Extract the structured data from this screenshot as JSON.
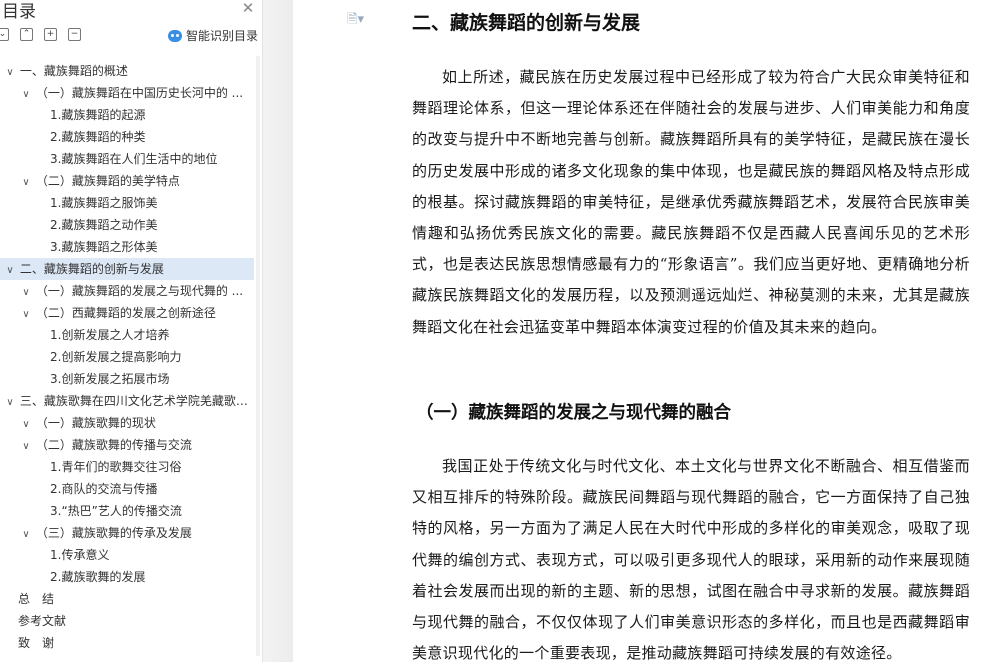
{
  "sidebar": {
    "title": "目录",
    "close_icon": "close-icon",
    "tools": [
      "collapse-all-icon",
      "expand-icon",
      "add-icon",
      "remove-icon"
    ],
    "ai_toc_label": "智能识别目录",
    "items": [
      {
        "label": "一、藏族舞蹈的概述",
        "level": 0,
        "expanded": true
      },
      {
        "label": "（一）藏族舞蹈在中国历史长河中的 ...",
        "level": 1,
        "expanded": true
      },
      {
        "label": "1.藏族舞蹈的起源",
        "level": 2
      },
      {
        "label": "2.藏族舞蹈的种类",
        "level": 2
      },
      {
        "label": "3.藏族舞蹈在人们生活中的地位",
        "level": 2
      },
      {
        "label": "（二）藏族舞蹈的美学特点",
        "level": 1,
        "expanded": true
      },
      {
        "label": "1.藏族舞蹈之服饰美",
        "level": 2
      },
      {
        "label": "2.藏族舞蹈之动作美",
        "level": 2
      },
      {
        "label": "3.藏族舞蹈之形体美",
        "level": 2
      },
      {
        "label": "二、藏族舞蹈的创新与发展",
        "level": 0,
        "expanded": true,
        "active": true
      },
      {
        "label": "（一）藏族舞蹈的发展之与现代舞的 ...",
        "level": 1
      },
      {
        "label": "（二）西藏舞蹈的发展之创新途径",
        "level": 1,
        "expanded": true
      },
      {
        "label": "1.创新发展之人才培养",
        "level": 2
      },
      {
        "label": "2.创新发展之提高影响力",
        "level": 2
      },
      {
        "label": "3.创新发展之拓展市场",
        "level": 2
      },
      {
        "label": "三、藏族歌舞在四川文化艺术学院羌藏歌 ...",
        "level": 0,
        "expanded": true
      },
      {
        "label": "（一）藏族歌舞的现状",
        "level": 1
      },
      {
        "label": "（二）藏族歌舞的传播与交流",
        "level": 1,
        "expanded": true
      },
      {
        "label": "1.青年们的歌舞交往习俗",
        "level": 2
      },
      {
        "label": "2.商队的交流与传播",
        "level": 2
      },
      {
        "label": "3.“热巴”艺人的传播交流",
        "level": 2
      },
      {
        "label": "（三）藏族歌舞的传承及发展",
        "level": 1,
        "expanded": true
      },
      {
        "label": "1.传承意义",
        "level": 2
      },
      {
        "label": "2.藏族歌舞的发展",
        "level": 2
      },
      {
        "label": "总　结",
        "level": 0,
        "leaf": true
      },
      {
        "label": "参考文献",
        "level": 0,
        "leaf": true
      },
      {
        "label": "致　谢",
        "level": 0,
        "leaf": true
      }
    ]
  },
  "document": {
    "heading1": "二、藏族舞蹈的创新与发展",
    "paragraph1": "如上所述，藏民族在历史发展过程中已经形成了较为符合广大民众审美特征和舞蹈理论体系，但这一理论体系还在伴随社会的发展与进步、人们审美能力和角度的改变与提升中不断地完善与创新。藏族舞蹈所具有的美学特征，是藏民族在漫长的历史发展中形成的诸多文化现象的集中体现，也是藏民族的舞蹈风格及特点形成的根基。探讨藏族舞蹈的审美特征，是继承优秀藏族舞蹈艺术，发展符合民族审美情趣和弘扬优秀民族文化的需要。藏民族舞蹈不仅是西藏人民喜闻乐见的艺术形式，也是表达民族思想情感最有力的“形象语言”。我们应当更好地、更精确地分析藏族民族舞蹈文化的发展历程，以及预测遥远灿烂、神秘莫测的未来，尤其是藏族舞蹈文化在社会迅猛变革中舞蹈本体演变过程的价值及其未来的趋向。",
    "heading2": "（一）藏族舞蹈的发展之与现代舞的融合",
    "paragraph2": "我国正处于传统文化与时代文化、本土文化与世界文化不断融合、相互借鉴而又相互排斥的特殊阶段。藏族民间舞蹈与现代舞蹈的融合，它一方面保持了自己独特的风格，另一方面为了满足人民在大时代中形成的多样化的审美观念，吸取了现代舞的编创方式、表现方式，可以吸引更多现代人的眼球，采用新的动作来展现随着社会发展而出现的新的主题、新的思想，试图在融合中寻求新的发展。藏族舞蹈与现代舞的融合，不仅仅体现了人们审美意识形态的多样化，而且也是西藏舞蹈审美意识现代化的一个重要表现，是推动藏族舞蹈可持续发展的有效途径。"
  }
}
